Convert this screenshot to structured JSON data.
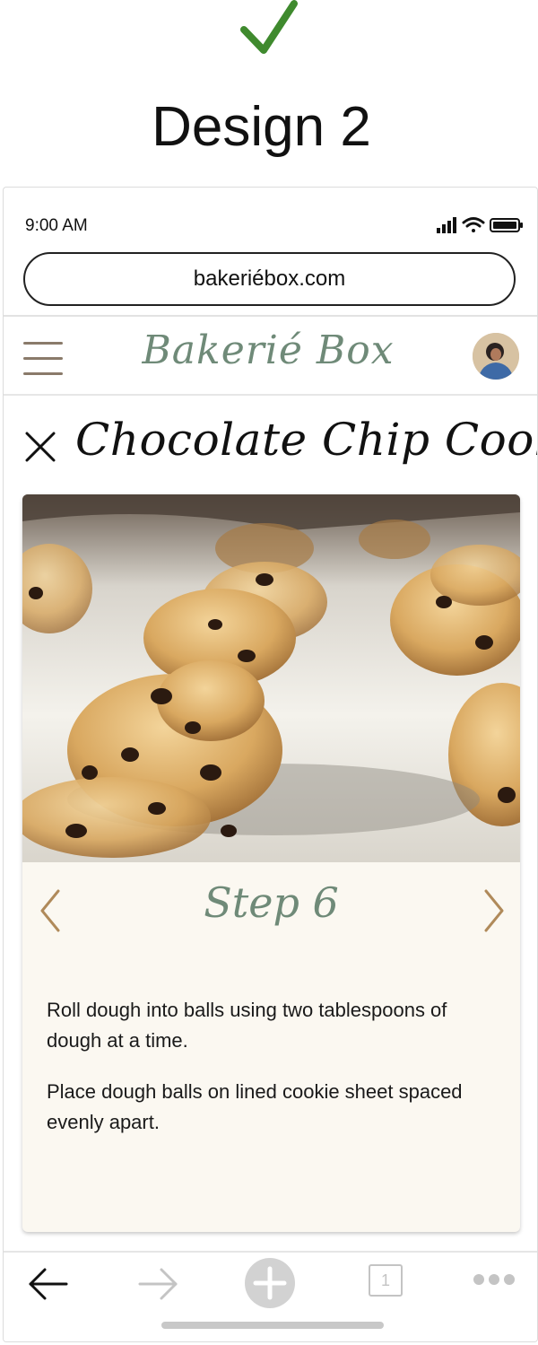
{
  "header": {
    "design_label": "Design 2",
    "accent_color": "#3f8a2e"
  },
  "status_bar": {
    "time": "9:00 AM",
    "icons": [
      "signal-icon",
      "wifi-icon",
      "battery-icon"
    ]
  },
  "browser": {
    "url": "bakeriébox.com"
  },
  "app_bar": {
    "brand": "Bakerié Box",
    "menu_icon": "hamburger-icon",
    "brand_color": "#6f8a78"
  },
  "recipe": {
    "title": "Chocolate Chip Cookies",
    "step": {
      "title": "Step 6",
      "paragraphs": [
        "Roll dough into balls using two tablespoons of dough at a time.",
        "Place dough balls on lined cookie sheet spaced evenly apart."
      ]
    },
    "arrow_color": "#b08a5a",
    "card_color": "#fbf8f1"
  },
  "bottom_bar": {
    "items": [
      "back-arrow-icon",
      "forward-arrow-icon",
      "add-tab-icon",
      "tabs-count-icon",
      "more-icon"
    ],
    "tab_count": "1"
  }
}
